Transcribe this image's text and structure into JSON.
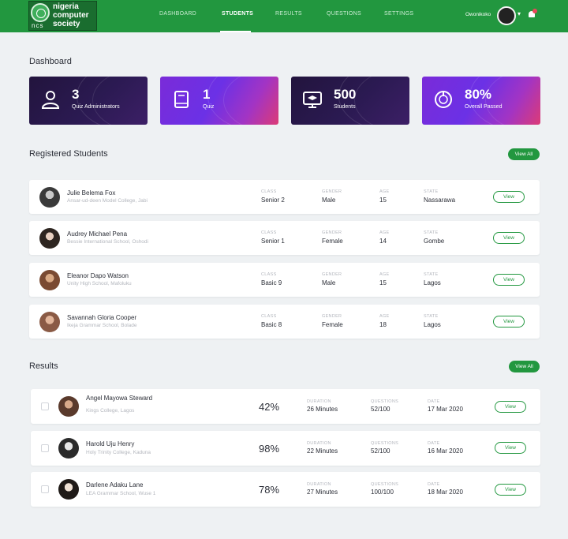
{
  "header": {
    "logo_text": "nigeria computer society",
    "logo_abbr": "ncs",
    "nav": [
      {
        "label": "DASHBOARD"
      },
      {
        "label": "STUDENTS"
      },
      {
        "label": "RESULTS"
      },
      {
        "label": "QUESTIONS"
      },
      {
        "label": "SETTINGS"
      }
    ],
    "active_nav": "STUDENTS",
    "user_name": "Owonikoko",
    "brand_color": "#22973f"
  },
  "dashboard": {
    "title": "Dashboard",
    "stats": [
      {
        "value": "3",
        "label": "Quiz Administrators",
        "icon": "user-icon"
      },
      {
        "value": "1",
        "label": "Quiz",
        "icon": "book-icon"
      },
      {
        "value": "500",
        "label": "Students",
        "icon": "monitor-graduation-cap-icon"
      },
      {
        "value": "80%",
        "label": "Overall Passed",
        "icon": "gauge-icon"
      }
    ]
  },
  "registered": {
    "title": "Registered Students",
    "view_all": "View All",
    "field_labels": {
      "class": "CLASS",
      "gender": "GENDER",
      "age": "AGE",
      "state": "STATE"
    },
    "view_label": "View",
    "students": [
      {
        "name": "Julie Belema Fox",
        "school": "Ansar-ud-deen Model College, Jabi",
        "class": "Senior 2",
        "gender": "Male",
        "age": "15",
        "state": "Nassarawa"
      },
      {
        "name": "Audrey Michael Pena",
        "school": "Bessie International School, Oshodi",
        "class": "Senior 1",
        "gender": "Female",
        "age": "14",
        "state": "Gombe"
      },
      {
        "name": "Eleanor Dapo Watson",
        "school": "Unity High School, Mafoluku",
        "class": "Basic 9",
        "gender": "Male",
        "age": "15",
        "state": "Lagos"
      },
      {
        "name": "Savannah Gloria Cooper",
        "school": "Ikeja Grammar School, Bolade",
        "class": "Basic 8",
        "gender": "Female",
        "age": "18",
        "state": "Lagos"
      }
    ]
  },
  "results": {
    "title": "Results",
    "view_all": "View All",
    "field_labels": {
      "duration": "DURATION",
      "questions": "QUESTIONS",
      "date": "DATE"
    },
    "view_label": "View",
    "items": [
      {
        "name": "Angel Mayowa Steward",
        "school": "Kings College, Lagos",
        "score": "42%",
        "duration": "26 Minutes",
        "questions": "52/100",
        "date": "17 Mar 2020"
      },
      {
        "name": "Harold Uju Henry",
        "school": "Holy Trinity College, Kaduna",
        "score": "98%",
        "duration": "22 Minutes",
        "questions": "52/100",
        "date": "16 Mar 2020"
      },
      {
        "name": "Darlene Adaku Lane",
        "school": "LEA Grammar School, Wuse 1",
        "score": "78%",
        "duration": "27 Minutes",
        "questions": "100/100",
        "date": "18 Mar 2020"
      }
    ]
  }
}
